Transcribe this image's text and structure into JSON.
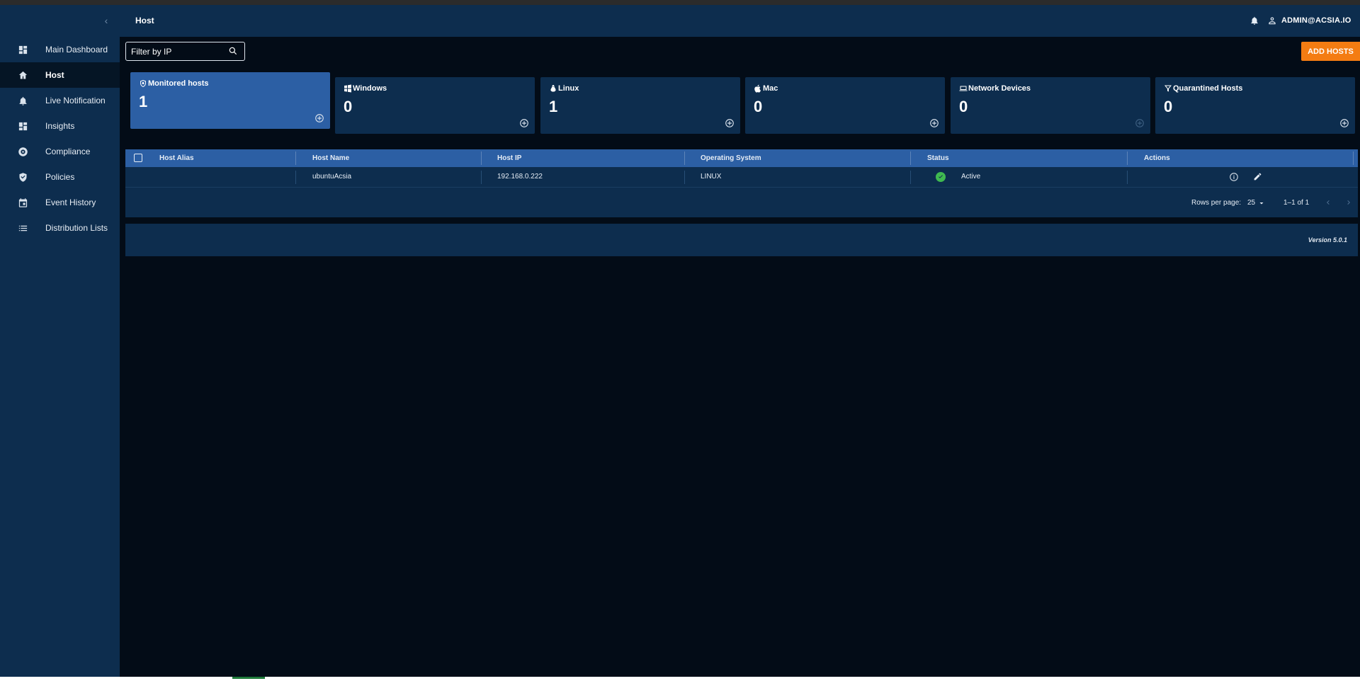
{
  "header": {
    "title": "Host",
    "username": "ADMIN@ACSIA.IO"
  },
  "sidebar": {
    "items": [
      {
        "label": "Main Dashboard",
        "icon": "dashboard-icon"
      },
      {
        "label": "Host",
        "icon": "home-icon"
      },
      {
        "label": "Live Notification",
        "icon": "bell-icon"
      },
      {
        "label": "Insights",
        "icon": "dashboard-icon"
      },
      {
        "label": "Compliance",
        "icon": "gear-icon"
      },
      {
        "label": "Policies",
        "icon": "shield-icon"
      },
      {
        "label": "Event History",
        "icon": "calendar-icon"
      },
      {
        "label": "Distribution Lists",
        "icon": "list-icon"
      }
    ],
    "active": "Host"
  },
  "filter": {
    "placeholder": "Filter by IP"
  },
  "actions": {
    "add_hosts": "ADD HOSTS"
  },
  "cards": [
    {
      "title": "Monitored hosts",
      "count": "1"
    },
    {
      "title": "Windows",
      "count": "0"
    },
    {
      "title": "Linux",
      "count": "1"
    },
    {
      "title": "Mac",
      "count": "0"
    },
    {
      "title": "Network Devices",
      "count": "0"
    },
    {
      "title": "Quarantined Hosts",
      "count": "0"
    }
  ],
  "table": {
    "columns": [
      "Host Alias",
      "Host Name",
      "Host IP",
      "Operating System",
      "Status",
      "Actions"
    ],
    "rows": [
      {
        "alias": "",
        "name": "ubuntuAcsia",
        "ip": "192.168.0.222",
        "os": "LINUX",
        "status": "Active"
      }
    ],
    "rows_per_page_label": "Rows per page:",
    "rows_per_page": "25",
    "range": "1–1 of 1"
  },
  "footer": {
    "version": "Version 5.0.1"
  },
  "colors": {
    "accent": "#2c5fa4",
    "panel": "#0d2d4e",
    "background": "#030c17",
    "button": "#f47c12",
    "status_active": "#3fb950"
  }
}
